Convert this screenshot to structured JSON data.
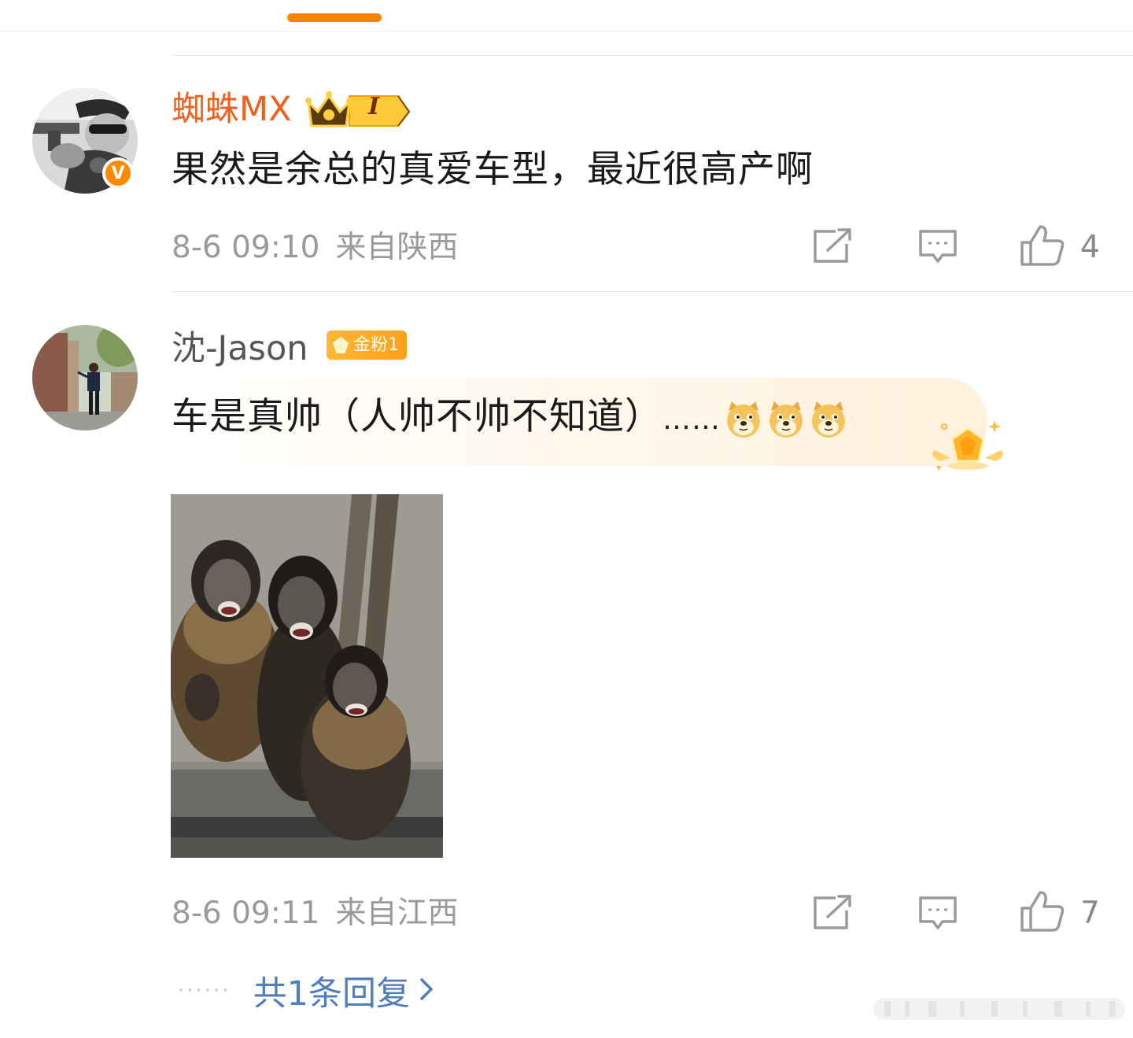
{
  "header": {
    "accent_color": "#ff8200"
  },
  "comments": [
    {
      "username": "蜘蛛MX",
      "level_badge": "I",
      "verified_badge": "V",
      "text": "果然是余总的真爱车型，最近很高产啊",
      "time": "8-6 09:10",
      "location": "来自陕西",
      "like_count": "4",
      "icons": [
        "share-icon",
        "comment-icon",
        "like-icon"
      ]
    },
    {
      "username": "沈-Jason",
      "fan_badge": "金粉1",
      "text": "车是真帅（人帅不帅不知道）",
      "ellipsis": "……",
      "emoji_count": 3,
      "time": "8-6 09:11",
      "location": "来自江西",
      "like_count": "7",
      "reply_summary": "共1条回复",
      "reply_dots": "······",
      "icons": [
        "share-icon",
        "comment-icon",
        "like-icon"
      ]
    }
  ],
  "colors": {
    "vip_name": "#f0601c",
    "link": "#4f7dbd",
    "meta": "#9a9a9a",
    "fan_badge": "#ffa01a"
  }
}
